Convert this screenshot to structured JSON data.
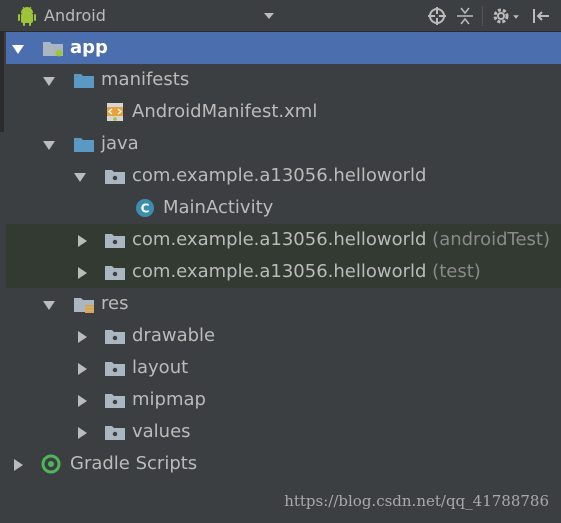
{
  "toolbar": {
    "view_selector": "Android",
    "icons": [
      "android-icon",
      "dropdown-arrow-icon",
      "locate-icon",
      "collapse-icon",
      "gear-icon",
      "hide-icon"
    ]
  },
  "tree": {
    "app": "app",
    "manifests": "manifests",
    "manifest_file": "AndroidManifest.xml",
    "java": "java",
    "pkg_main": "com.example.a13056.helloworld",
    "main_activity": "MainActivity",
    "pkg_android_test": "com.example.a13056.helloworld",
    "pkg_android_test_suffix": "(androidTest)",
    "pkg_test": "com.example.a13056.helloworld",
    "pkg_test_suffix": "(test)",
    "res": "res",
    "drawable": "drawable",
    "layout": "layout",
    "mipmap": "mipmap",
    "values": "values",
    "gradle_scripts": "Gradle Scripts"
  },
  "watermark": "https://blog.csdn.net/qq_41788786",
  "colors": {
    "background": "#3c3f41",
    "selection": "#4b6eaf",
    "folder": "#5a99c4",
    "android_green": "#9fc43a",
    "gradle_green": "#4eb55a"
  }
}
